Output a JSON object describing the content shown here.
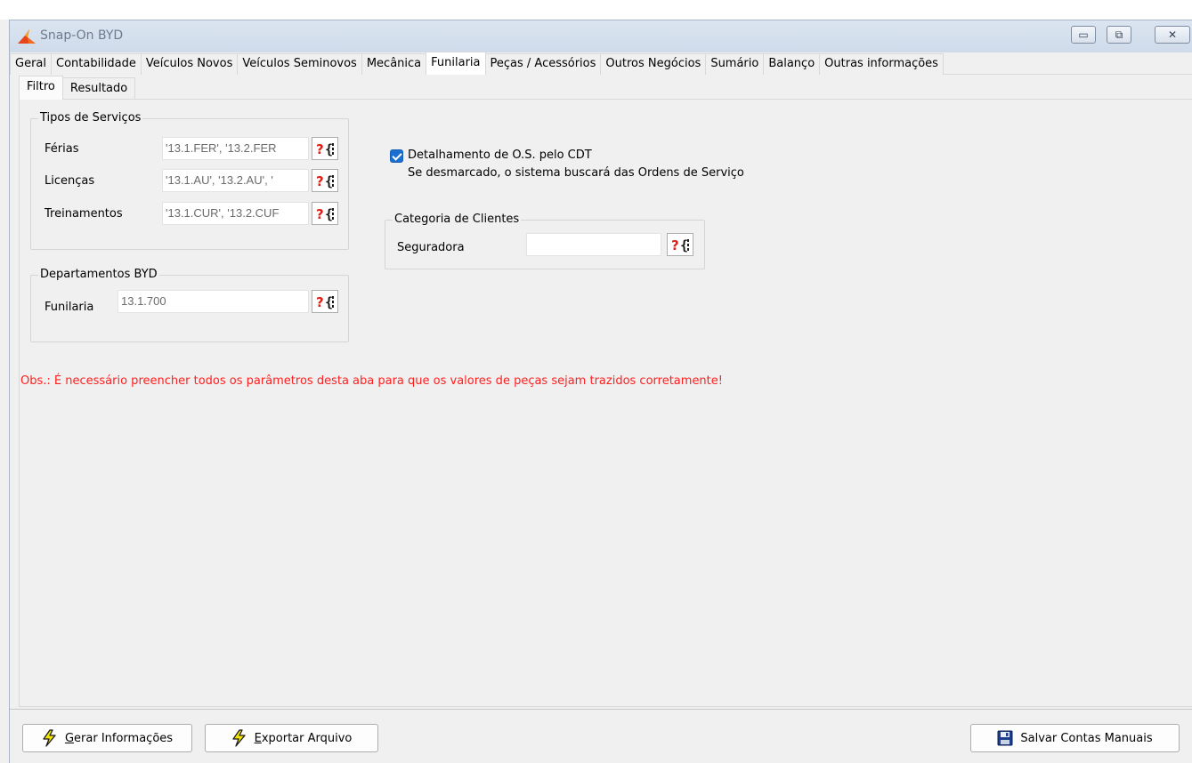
{
  "window": {
    "title": "Snap-On BYD",
    "controls": {
      "minimize": "▭",
      "restore": "⧉",
      "close": "✕"
    }
  },
  "tabs": [
    {
      "label": "Geral"
    },
    {
      "label": "Contabilidade"
    },
    {
      "label": "Veículos Novos"
    },
    {
      "label": "Veículos Seminovos"
    },
    {
      "label": "Mecânica"
    },
    {
      "label": "Funilaria",
      "active": true
    },
    {
      "label": "Peças / Acessórios"
    },
    {
      "label": "Outros Negócios"
    },
    {
      "label": "Sumário"
    },
    {
      "label": "Balanço"
    },
    {
      "label": "Outras informações"
    }
  ],
  "subtabs": {
    "filtro": "Filtro",
    "resultado": "Resultado"
  },
  "tipos_servicos": {
    "legend": "Tipos de Serviços",
    "ferias": {
      "label": "Férias",
      "value": "'13.1.FER', '13.2.FER"
    },
    "licencas": {
      "label": "Licenças",
      "value": "'13.1.AU', '13.2.AU', '"
    },
    "treinamentos": {
      "label": "Treinamentos",
      "value": "'13.1.CUR', '13.2.CUF"
    }
  },
  "departamentos": {
    "legend": "Departamentos BYD",
    "funilaria": {
      "label": "Funilaria",
      "value": "13.1.700"
    }
  },
  "detalhamento": {
    "checked": true,
    "label": "Detalhamento de O.S. pelo CDT",
    "hint": "Se desmarcado, o sistema buscará das Ordens de Serviço"
  },
  "categoria": {
    "legend": "Categoria de Clientes",
    "seguradora": {
      "label": "Seguradora",
      "value": ""
    }
  },
  "query_button": {
    "q": "?",
    "brace": "{"
  },
  "obs": "Obs.: É necessário preencher todos os parâmetros desta aba para que os valores de peças sejam trazidos corretamente!",
  "buttons": {
    "gerar": {
      "mnemonic": "G",
      "rest": "erar Informações"
    },
    "exportar": {
      "mnemonic": "E",
      "rest": "xportar Arquivo"
    },
    "salvar": "Salvar Contas Manuais"
  },
  "colors": {
    "obs_text": "#ff2020",
    "checkbox": "#1c6fd0",
    "query_q": "#e0201a",
    "lightning": "#f2e600"
  }
}
